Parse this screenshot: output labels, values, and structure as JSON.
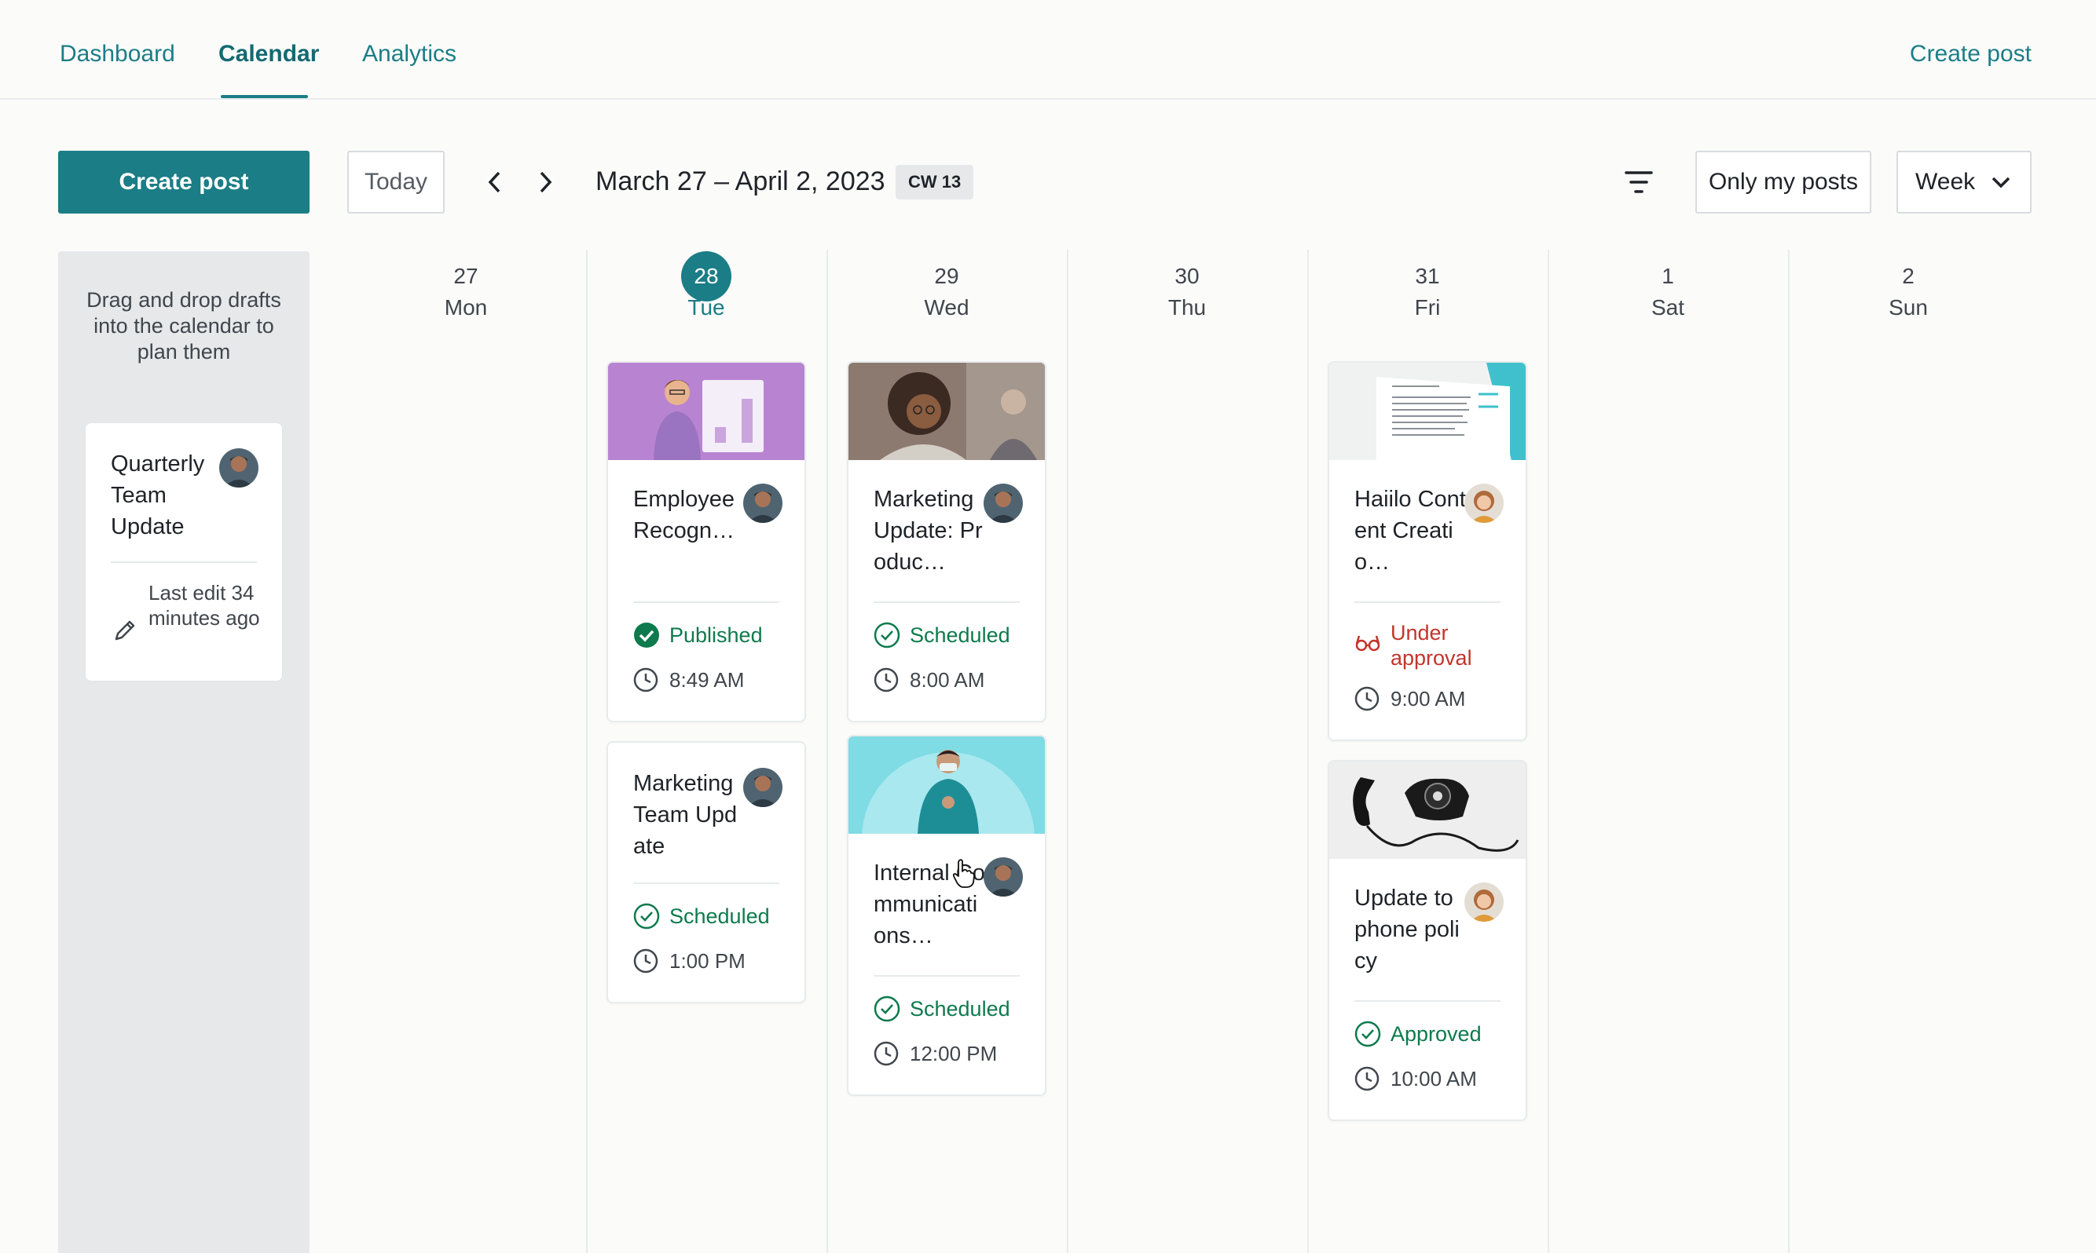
{
  "nav": {
    "tabs": [
      {
        "label": "Dashboard"
      },
      {
        "label": "Calendar"
      },
      {
        "label": "Analytics"
      }
    ],
    "create_post": "Create post"
  },
  "toolbar": {
    "create_post": "Create post",
    "today": "Today",
    "date_range": "March 27 – April 2, 2023",
    "cw": "CW 13",
    "only_my_posts": "Only my posts",
    "view": "Week"
  },
  "drafts": {
    "hint": "Drag and drop drafts into the calendar to plan them",
    "items": [
      {
        "title": "Quarterly Team Update",
        "last_edit": "Last edit 34 minutes ago"
      }
    ]
  },
  "days": [
    {
      "num": "27",
      "name": "Mon"
    },
    {
      "num": "28",
      "name": "Tue"
    },
    {
      "num": "29",
      "name": "Wed"
    },
    {
      "num": "30",
      "name": "Thu"
    },
    {
      "num": "31",
      "name": "Fri"
    },
    {
      "num": "1",
      "name": "Sat"
    },
    {
      "num": "2",
      "name": "Sun"
    }
  ],
  "posts": {
    "tue_1": {
      "title": "Employee Recogn…",
      "status": "Published",
      "time": "8:49 AM"
    },
    "tue_2": {
      "title": "Marketing Team Update",
      "status": "Scheduled",
      "time": "1:00 PM"
    },
    "wed_1": {
      "title": "Marketing Update: Produc…",
      "status": "Scheduled",
      "time": "8:00 AM"
    },
    "wed_2": {
      "title": "Internal Communications…",
      "status": "Scheduled",
      "time": "12:00 PM"
    },
    "fri_1": {
      "title": "Haiilo Content Creatio…",
      "status": "Under approval",
      "time": "9:00 AM"
    },
    "fri_2": {
      "title": "Update to phone policy",
      "status": "Approved",
      "time": "10:00 AM"
    }
  },
  "colors": {
    "accent": "#1b7d86",
    "success": "#0e7a4d",
    "warning": "#c2352b"
  }
}
